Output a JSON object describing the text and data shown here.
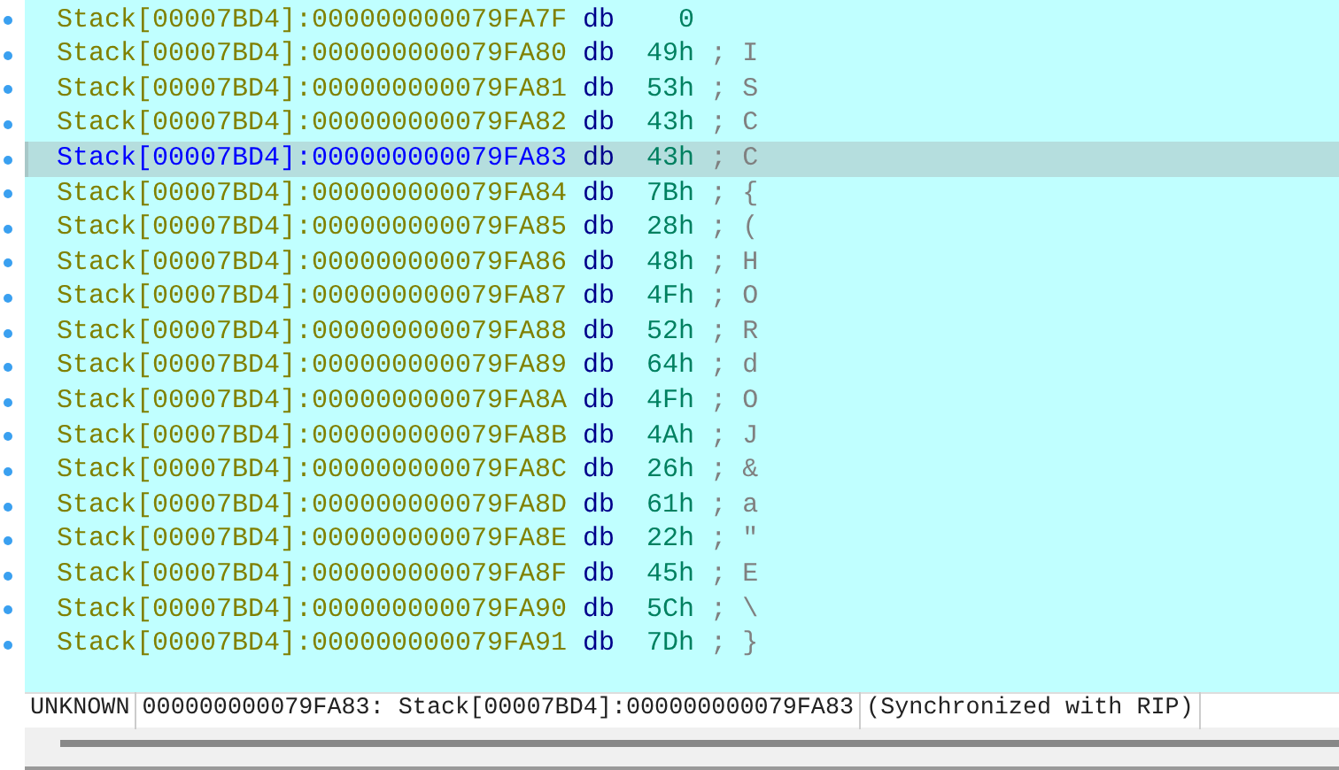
{
  "listing": [
    {
      "address": "Stack[00007BD4]:000000000079FA7F",
      "directive": "db",
      "value": "0",
      "selected": false
    },
    {
      "address": "Stack[00007BD4]:000000000079FA80",
      "directive": "db",
      "value": "49h",
      "comment": "; I",
      "selected": false
    },
    {
      "address": "Stack[00007BD4]:000000000079FA81",
      "directive": "db",
      "value": "53h",
      "comment": "; S",
      "selected": false
    },
    {
      "address": "Stack[00007BD4]:000000000079FA82",
      "directive": "db",
      "value": "43h",
      "comment": "; C",
      "selected": false
    },
    {
      "address": "Stack[00007BD4]:000000000079FA83",
      "directive": "db",
      "value": "43h",
      "comment": "; C",
      "selected": true
    },
    {
      "address": "Stack[00007BD4]:000000000079FA84",
      "directive": "db",
      "value": "7Bh",
      "comment": "; {",
      "selected": false
    },
    {
      "address": "Stack[00007BD4]:000000000079FA85",
      "directive": "db",
      "value": "28h",
      "comment": "; (",
      "selected": false
    },
    {
      "address": "Stack[00007BD4]:000000000079FA86",
      "directive": "db",
      "value": "48h",
      "comment": "; H",
      "selected": false
    },
    {
      "address": "Stack[00007BD4]:000000000079FA87",
      "directive": "db",
      "value": "4Fh",
      "comment": "; O",
      "selected": false
    },
    {
      "address": "Stack[00007BD4]:000000000079FA88",
      "directive": "db",
      "value": "52h",
      "comment": "; R",
      "selected": false
    },
    {
      "address": "Stack[00007BD4]:000000000079FA89",
      "directive": "db",
      "value": "64h",
      "comment": "; d",
      "selected": false
    },
    {
      "address": "Stack[00007BD4]:000000000079FA8A",
      "directive": "db",
      "value": "4Fh",
      "comment": "; O",
      "selected": false
    },
    {
      "address": "Stack[00007BD4]:000000000079FA8B",
      "directive": "db",
      "value": "4Ah",
      "comment": "; J",
      "selected": false
    },
    {
      "address": "Stack[00007BD4]:000000000079FA8C",
      "directive": "db",
      "value": "26h",
      "comment": "; &",
      "selected": false
    },
    {
      "address": "Stack[00007BD4]:000000000079FA8D",
      "directive": "db",
      "value": "61h",
      "comment": "; a",
      "selected": false
    },
    {
      "address": "Stack[00007BD4]:000000000079FA8E",
      "directive": "db",
      "value": "22h",
      "comment": "; \"",
      "selected": false
    },
    {
      "address": "Stack[00007BD4]:000000000079FA8F",
      "directive": "db",
      "value": "45h",
      "comment": "; E",
      "selected": false
    },
    {
      "address": "Stack[00007BD4]:000000000079FA90",
      "directive": "db",
      "value": "5Ch",
      "comment": "; \\",
      "selected": false
    },
    {
      "address": "Stack[00007BD4]:000000000079FA91",
      "directive": "db",
      "value": "7Dh",
      "comment": "; }",
      "selected": false
    }
  ],
  "status_bar": [
    "UNKNOWN",
    "000000000079FA83: Stack[00007BD4]:000000000079FA83",
    "(Synchronized with RIP)"
  ]
}
